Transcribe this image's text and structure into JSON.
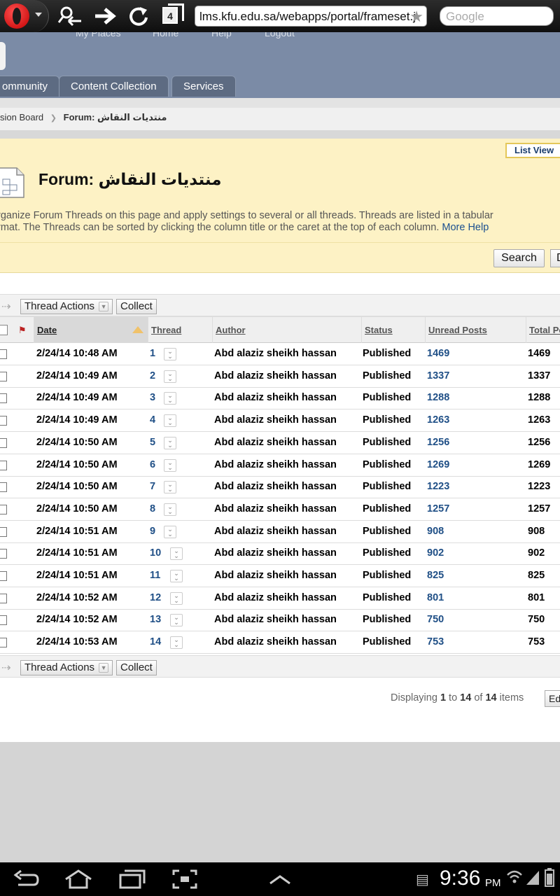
{
  "browser": {
    "tab_count": "4",
    "url": "lms.kfu.edu.sa/webapps/portal/frameset.j",
    "search_placeholder": "Google"
  },
  "header": {
    "top_links": [
      "My Places",
      "Home",
      "Help",
      "Logout"
    ],
    "tabs": [
      "ommunity",
      "Content Collection",
      "Services"
    ]
  },
  "breadcrumb": {
    "parent": "sion Board",
    "current_prefix": "Forum:",
    "current_name": "منتديات النقاش"
  },
  "page": {
    "list_view_label": "List View",
    "title": "Forum: منتديات النقاش",
    "description_line1": "rganize Forum Threads on this page and apply settings to several or all threads. Threads are listed in a tabular",
    "description_line2": "rmat. The Threads can be sorted by clicking the column title or the caret at the top of each column.",
    "more_help": "More Help",
    "search_button": "Search",
    "cut_button": "D"
  },
  "actions": {
    "thread_actions": "Thread Actions",
    "collect": "Collect"
  },
  "table": {
    "columns": [
      "Date",
      "Thread",
      "Author",
      "Status",
      "Unread Posts",
      "Total Po"
    ],
    "rows": [
      {
        "date": "2/24/14 10:48 AM",
        "thread": "1",
        "author": "Abd alaziz sheikh hassan",
        "status": "Published",
        "unread": "1469",
        "total": "1469"
      },
      {
        "date": "2/24/14 10:49 AM",
        "thread": "2",
        "author": "Abd alaziz sheikh hassan",
        "status": "Published",
        "unread": "1337",
        "total": "1337"
      },
      {
        "date": "2/24/14 10:49 AM",
        "thread": "3",
        "author": "Abd alaziz sheikh hassan",
        "status": "Published",
        "unread": "1288",
        "total": "1288"
      },
      {
        "date": "2/24/14 10:49 AM",
        "thread": "4",
        "author": "Abd alaziz sheikh hassan",
        "status": "Published",
        "unread": "1263",
        "total": "1263"
      },
      {
        "date": "2/24/14 10:50 AM",
        "thread": "5",
        "author": "Abd alaziz sheikh hassan",
        "status": "Published",
        "unread": "1256",
        "total": "1256"
      },
      {
        "date": "2/24/14 10:50 AM",
        "thread": "6",
        "author": "Abd alaziz sheikh hassan",
        "status": "Published",
        "unread": "1269",
        "total": "1269"
      },
      {
        "date": "2/24/14 10:50 AM",
        "thread": "7",
        "author": "Abd alaziz sheikh hassan",
        "status": "Published",
        "unread": "1223",
        "total": "1223"
      },
      {
        "date": "2/24/14 10:50 AM",
        "thread": "8",
        "author": "Abd alaziz sheikh hassan",
        "status": "Published",
        "unread": "1257",
        "total": "1257"
      },
      {
        "date": "2/24/14 10:51 AM",
        "thread": "9",
        "author": "Abd alaziz sheikh hassan",
        "status": "Published",
        "unread": "908",
        "total": "908"
      },
      {
        "date": "2/24/14 10:51 AM",
        "thread": "10",
        "author": "Abd alaziz sheikh hassan",
        "status": "Published",
        "unread": "902",
        "total": "902"
      },
      {
        "date": "2/24/14 10:51 AM",
        "thread": "11",
        "author": "Abd alaziz sheikh hassan",
        "status": "Published",
        "unread": "825",
        "total": "825"
      },
      {
        "date": "2/24/14 10:52 AM",
        "thread": "12",
        "author": "Abd alaziz sheikh hassan",
        "status": "Published",
        "unread": "801",
        "total": "801"
      },
      {
        "date": "2/24/14 10:52 AM",
        "thread": "13",
        "author": "Abd alaziz sheikh hassan",
        "status": "Published",
        "unread": "750",
        "total": "750"
      },
      {
        "date": "2/24/14 10:53 AM",
        "thread": "14",
        "author": "Abd alaziz sheikh hassan",
        "status": "Published",
        "unread": "753",
        "total": "753"
      }
    ]
  },
  "paging": {
    "prefix": "Displaying",
    "from": "1",
    "to_word": "to",
    "to": "14",
    "of_word": "of",
    "total": "14",
    "suffix": "items",
    "edit_label": "Ed"
  },
  "statusbar": {
    "time": "9:36",
    "ampm": "PM"
  },
  "icons": {
    "back": "back-arrow-icon",
    "home": "home-icon",
    "recent": "recent-apps-icon",
    "screenshot": "screenshot-icon",
    "up": "up-chevron-icon"
  },
  "colors": {
    "header_bg": "#7b8ba6",
    "page_header_bg": "#fdf2c5",
    "link": "#1f4f86"
  }
}
